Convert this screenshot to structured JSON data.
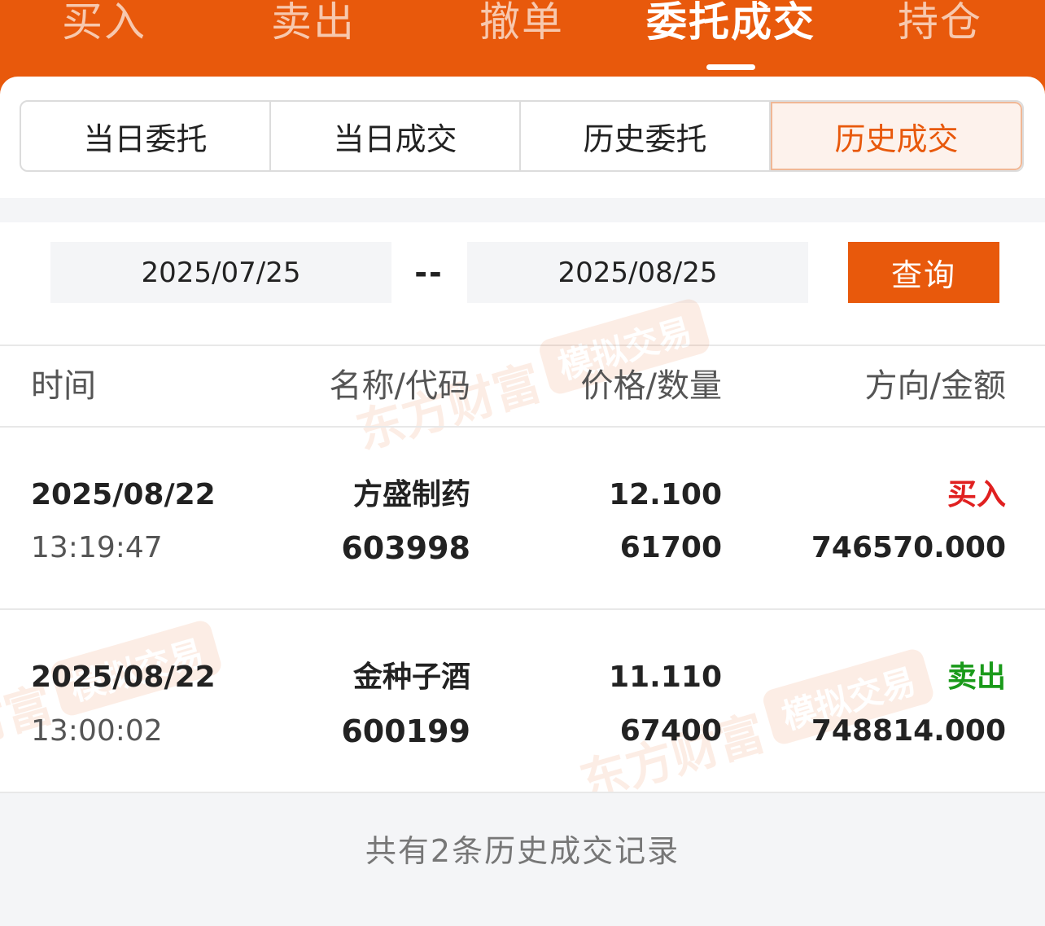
{
  "top_tabs": [
    {
      "label": "买入"
    },
    {
      "label": "卖出"
    },
    {
      "label": "撤单"
    },
    {
      "label": "委托成交"
    },
    {
      "label": "持仓"
    }
  ],
  "sub_tabs": [
    {
      "label": "当日委托"
    },
    {
      "label": "当日成交"
    },
    {
      "label": "历史委托"
    },
    {
      "label": "历史成交"
    }
  ],
  "date_filter": {
    "start": "2025/07/25",
    "separator": "--",
    "end": "2025/08/25",
    "query_label": "查询"
  },
  "table": {
    "headers": [
      "时间",
      "名称/代码",
      "价格/数量",
      "方向/金额"
    ],
    "rows": [
      {
        "date": "2025/08/22",
        "time": "13:19:47",
        "name": "方盛制药",
        "code": "603998",
        "price": "12.100",
        "quantity": "61700",
        "direction": "买入",
        "amount": "746570.000",
        "direction_color": "#e02020"
      },
      {
        "date": "2025/08/22",
        "time": "13:00:02",
        "name": "金种子酒",
        "code": "600199",
        "price": "11.110",
        "quantity": "67400",
        "direction": "卖出",
        "amount": "748814.000",
        "direction_color": "#1a9a1a"
      }
    ]
  },
  "footer": {
    "summary": "共有2条历史成交记录"
  },
  "watermark": {
    "brand": "东方财富",
    "badge": "模拟交易"
  },
  "colors": {
    "accent": "#e8590c",
    "buy": "#e02020",
    "sell": "#1a9a1a"
  }
}
